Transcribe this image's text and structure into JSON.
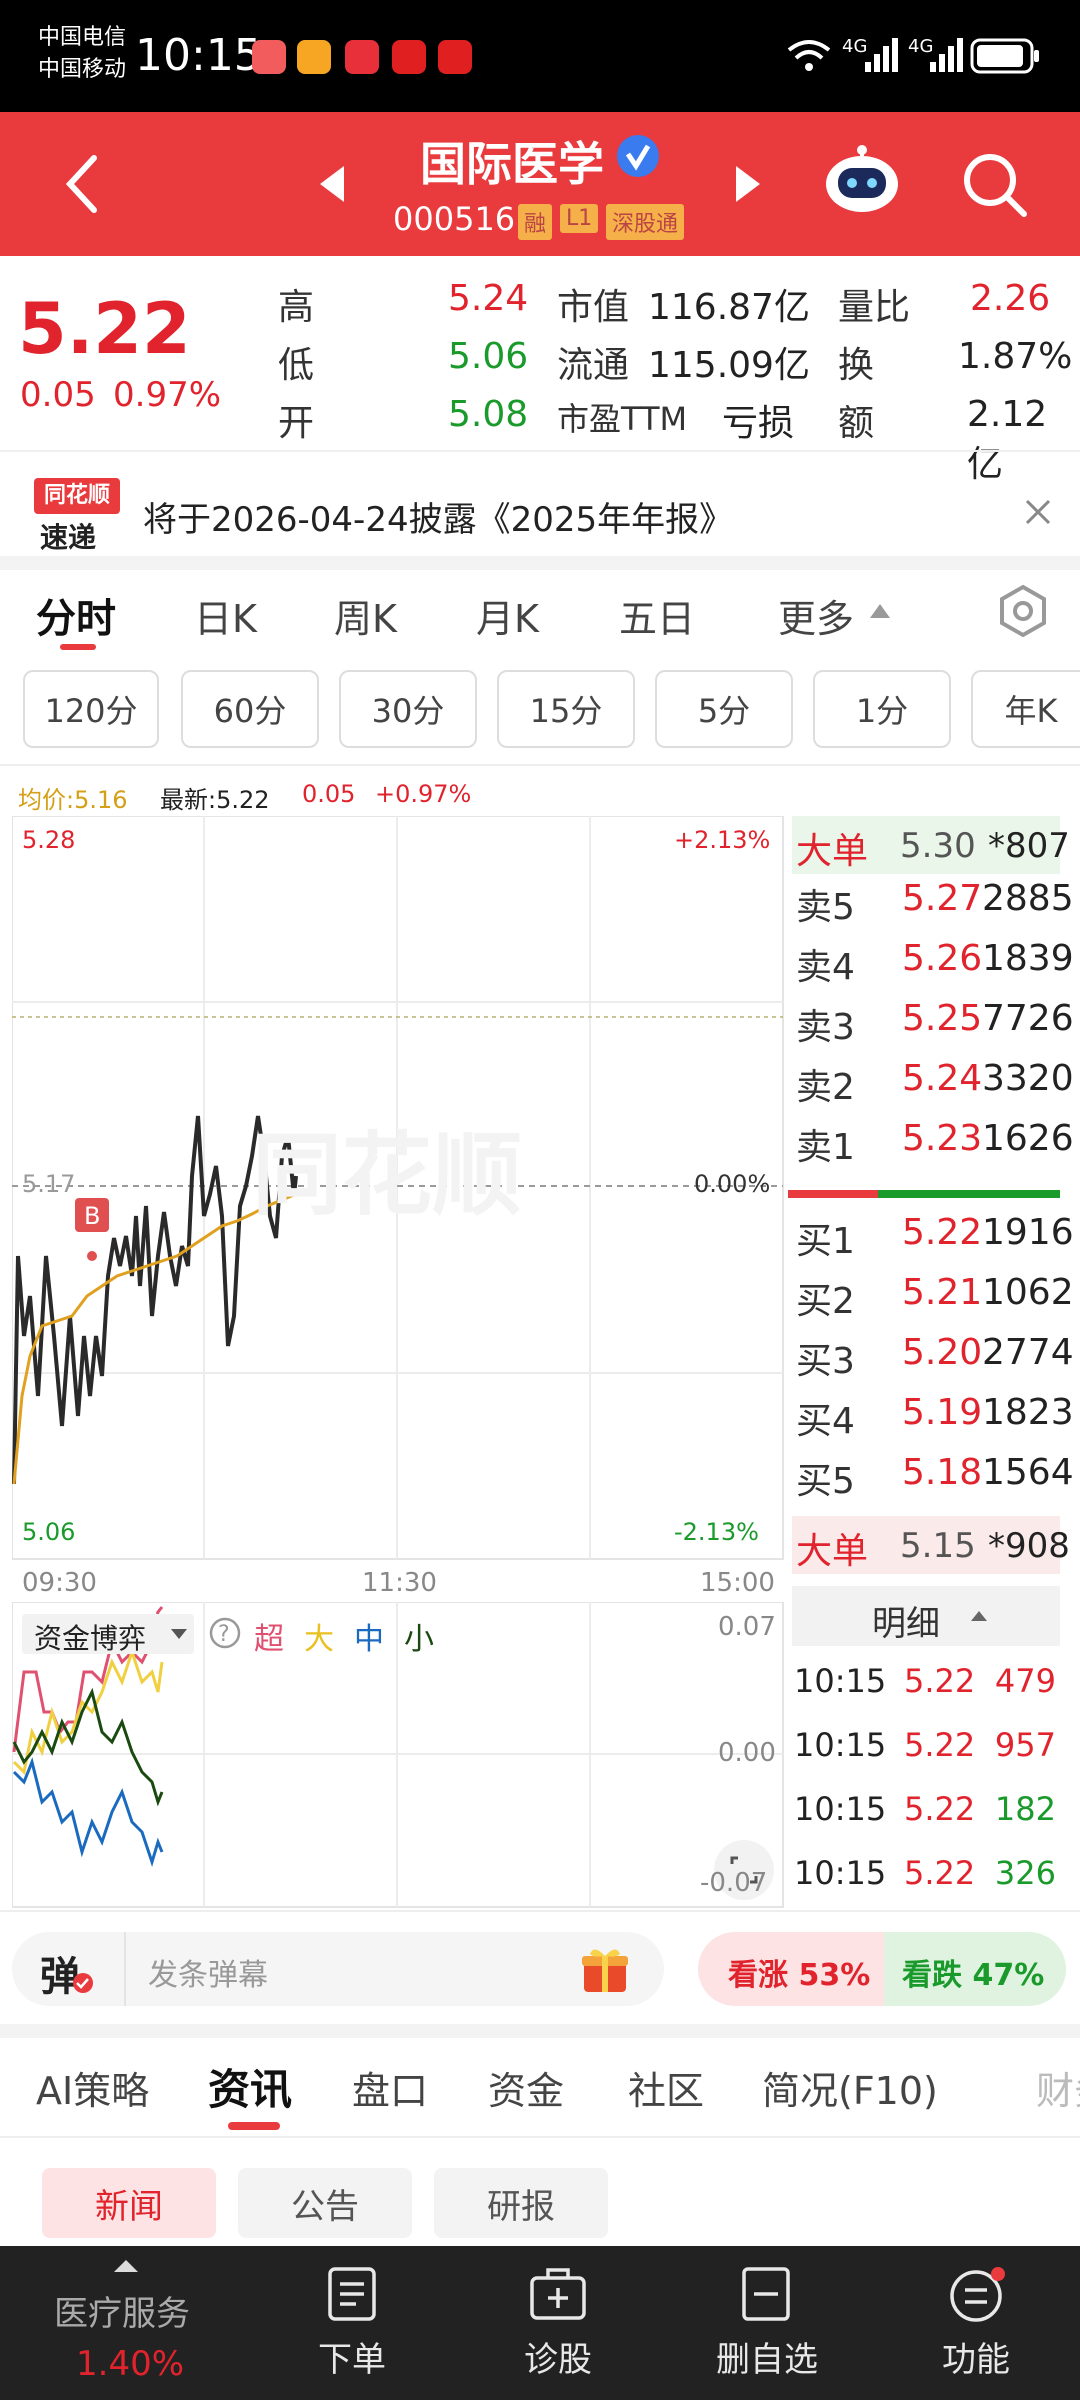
{
  "status_bar": {
    "carrier1": "中国电信",
    "carrier2": "中国移动",
    "time": "10:15",
    "signal1": "4G",
    "signal2": "4G"
  },
  "header": {
    "title": "国际医学",
    "code": "000516",
    "badges": [
      "融",
      "L1",
      "深股通"
    ]
  },
  "quote": {
    "price": "5.22",
    "change": "0.05",
    "change_pct": "0.97%",
    "high_label": "高",
    "high": "5.24",
    "low_label": "低",
    "low": "5.06",
    "open_label": "开",
    "open": "5.08",
    "mcap_label": "市值",
    "mcap": "116.87亿",
    "float_label": "流通",
    "float": "115.09亿",
    "pe_label": "市盈TTM",
    "pe": "亏损",
    "vr_label": "量比",
    "vr": "2.26",
    "turnover_label": "换",
    "turnover": "1.87%",
    "amount_label": "额",
    "amount": "2.12亿"
  },
  "notice": {
    "logo_top": "同花顺",
    "logo_bottom": "速递",
    "text": "将于2026-04-24披露《2025年年报》"
  },
  "period_tabs": [
    "分时",
    "日K",
    "周K",
    "月K",
    "五日",
    "更多"
  ],
  "timeframes": [
    "120分",
    "60分",
    "30分",
    "15分",
    "5分",
    "1分",
    "年K"
  ],
  "chart_info": {
    "avg": "均价:5.16",
    "latest": "最新:5.22",
    "chg": "0.05",
    "pct": "+0.97%",
    "top_price": "5.28",
    "mid_price": "5.17",
    "bottom_price": "5.06",
    "top_pct": "+2.13%",
    "mid_pct": "0.00%",
    "bottom_pct": "-2.13%",
    "time_start": "09:30",
    "time_mid": "11:30",
    "time_end": "15:00",
    "watermark": "同花顺",
    "b_marker": "B"
  },
  "chart_data": {
    "type": "line",
    "series": [],
    "ylim": [
      5.06,
      5.28
    ]
  },
  "fund_panel": {
    "title": "资金博弈",
    "legend": [
      "超",
      "大",
      "中",
      "小"
    ],
    "y_top": "0.07",
    "y_mid": "0.00",
    "y_bottom": "-0.07"
  },
  "orderbook": {
    "big_top": {
      "label": "大单",
      "price": "5.30",
      "vol": "*807"
    },
    "sells": [
      {
        "label": "卖5",
        "price": "5.27",
        "vol": "2885"
      },
      {
        "label": "卖4",
        "price": "5.26",
        "vol": "1839"
      },
      {
        "label": "卖3",
        "price": "5.25",
        "vol": "7726"
      },
      {
        "label": "卖2",
        "price": "5.24",
        "vol": "3320"
      },
      {
        "label": "卖1",
        "price": "5.23",
        "vol": "1626"
      }
    ],
    "buys": [
      {
        "label": "买1",
        "price": "5.22",
        "vol": "1916"
      },
      {
        "label": "买2",
        "price": "5.21",
        "vol": "1062"
      },
      {
        "label": "买3",
        "price": "5.20",
        "vol": "2774"
      },
      {
        "label": "买4",
        "price": "5.19",
        "vol": "1823"
      },
      {
        "label": "买5",
        "price": "5.18",
        "vol": "1564"
      }
    ],
    "big_bottom": {
      "label": "大单",
      "price": "5.15",
      "vol": "*908"
    },
    "detail_label": "明细",
    "ticks": [
      {
        "time": "10:15",
        "price": "5.22",
        "vol": "479"
      },
      {
        "time": "10:15",
        "price": "5.22",
        "vol": "957"
      },
      {
        "time": "10:15",
        "price": "5.22",
        "vol": "182"
      },
      {
        "time": "10:15",
        "price": "5.22",
        "vol": "326"
      }
    ]
  },
  "danmaku": {
    "icon_label": "弹",
    "placeholder": "发条弹幕",
    "bull_label": "看涨 53%",
    "bear_label": "看跌 47%"
  },
  "info_tabs": [
    "AI策略",
    "资讯",
    "盘口",
    "资金",
    "社区",
    "简况(F10)",
    "财务"
  ],
  "news_tabs": [
    "新闻",
    "公告",
    "研报"
  ],
  "bottom_nav": {
    "sector": "医疗服务",
    "sector_pct": "1.40%",
    "items": [
      "下单",
      "诊股",
      "删自选",
      "功能"
    ]
  },
  "colors": {
    "header_red": "#e93a3e",
    "up_red": "#e0232c",
    "down_green": "#1a9a2b"
  }
}
